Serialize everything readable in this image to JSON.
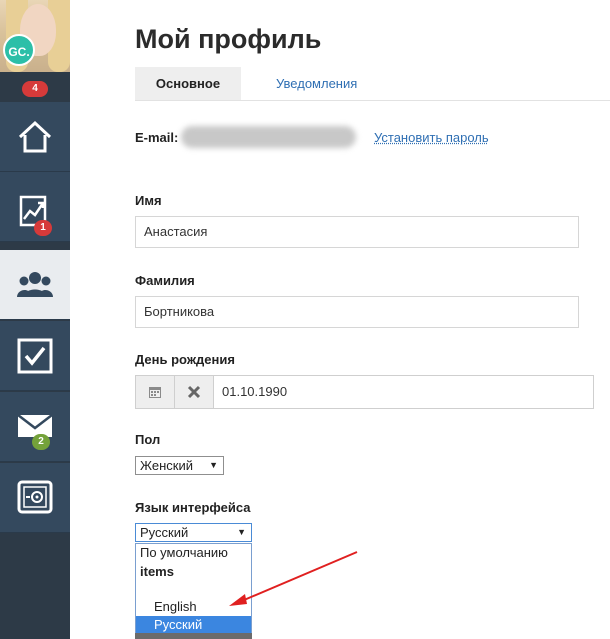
{
  "sidebar": {
    "avatar_initials": "GC.",
    "notification_count": "4",
    "items": [
      {
        "name": "home",
        "icon": "home-icon",
        "badge": ""
      },
      {
        "name": "reports",
        "icon": "chart-icon",
        "badge": "1",
        "badge_color": "#d63a3a"
      },
      {
        "name": "people",
        "icon": "users-icon",
        "badge": "",
        "active": true
      },
      {
        "name": "tasks",
        "icon": "checkbox-icon",
        "badge": ""
      },
      {
        "name": "messages",
        "icon": "mail-icon",
        "badge": "2",
        "badge_color": "#74a23a"
      },
      {
        "name": "safe",
        "icon": "safe-icon",
        "badge": ""
      }
    ]
  },
  "page": {
    "title": "Мой профиль",
    "tabs": [
      {
        "label": "Основное",
        "active": true
      },
      {
        "label": "Уведомления",
        "active": false
      }
    ]
  },
  "form": {
    "email_label": "E-mail:",
    "set_password_link": "Установить пароль",
    "first_name_label": "Имя",
    "first_name_value": "Анастасия",
    "last_name_label": "Фамилия",
    "last_name_value": "Бортникова",
    "birthday_label": "День рождения",
    "birthday_value": "01.10.1990",
    "gender_label": "Пол",
    "gender_value": "Женский",
    "language_label": "Язык интерфейса",
    "language_value": "Русский",
    "language_options": {
      "default": "По умолчанию",
      "group": "items",
      "english": "English",
      "russian": "Русский"
    }
  },
  "colors": {
    "sidebar_bg": "#34495e",
    "link": "#2f6fb3",
    "badge_red": "#d63a3a",
    "badge_green": "#74a23a",
    "selected_option": "#3b86e0",
    "annotation_arrow": "#e02020"
  }
}
